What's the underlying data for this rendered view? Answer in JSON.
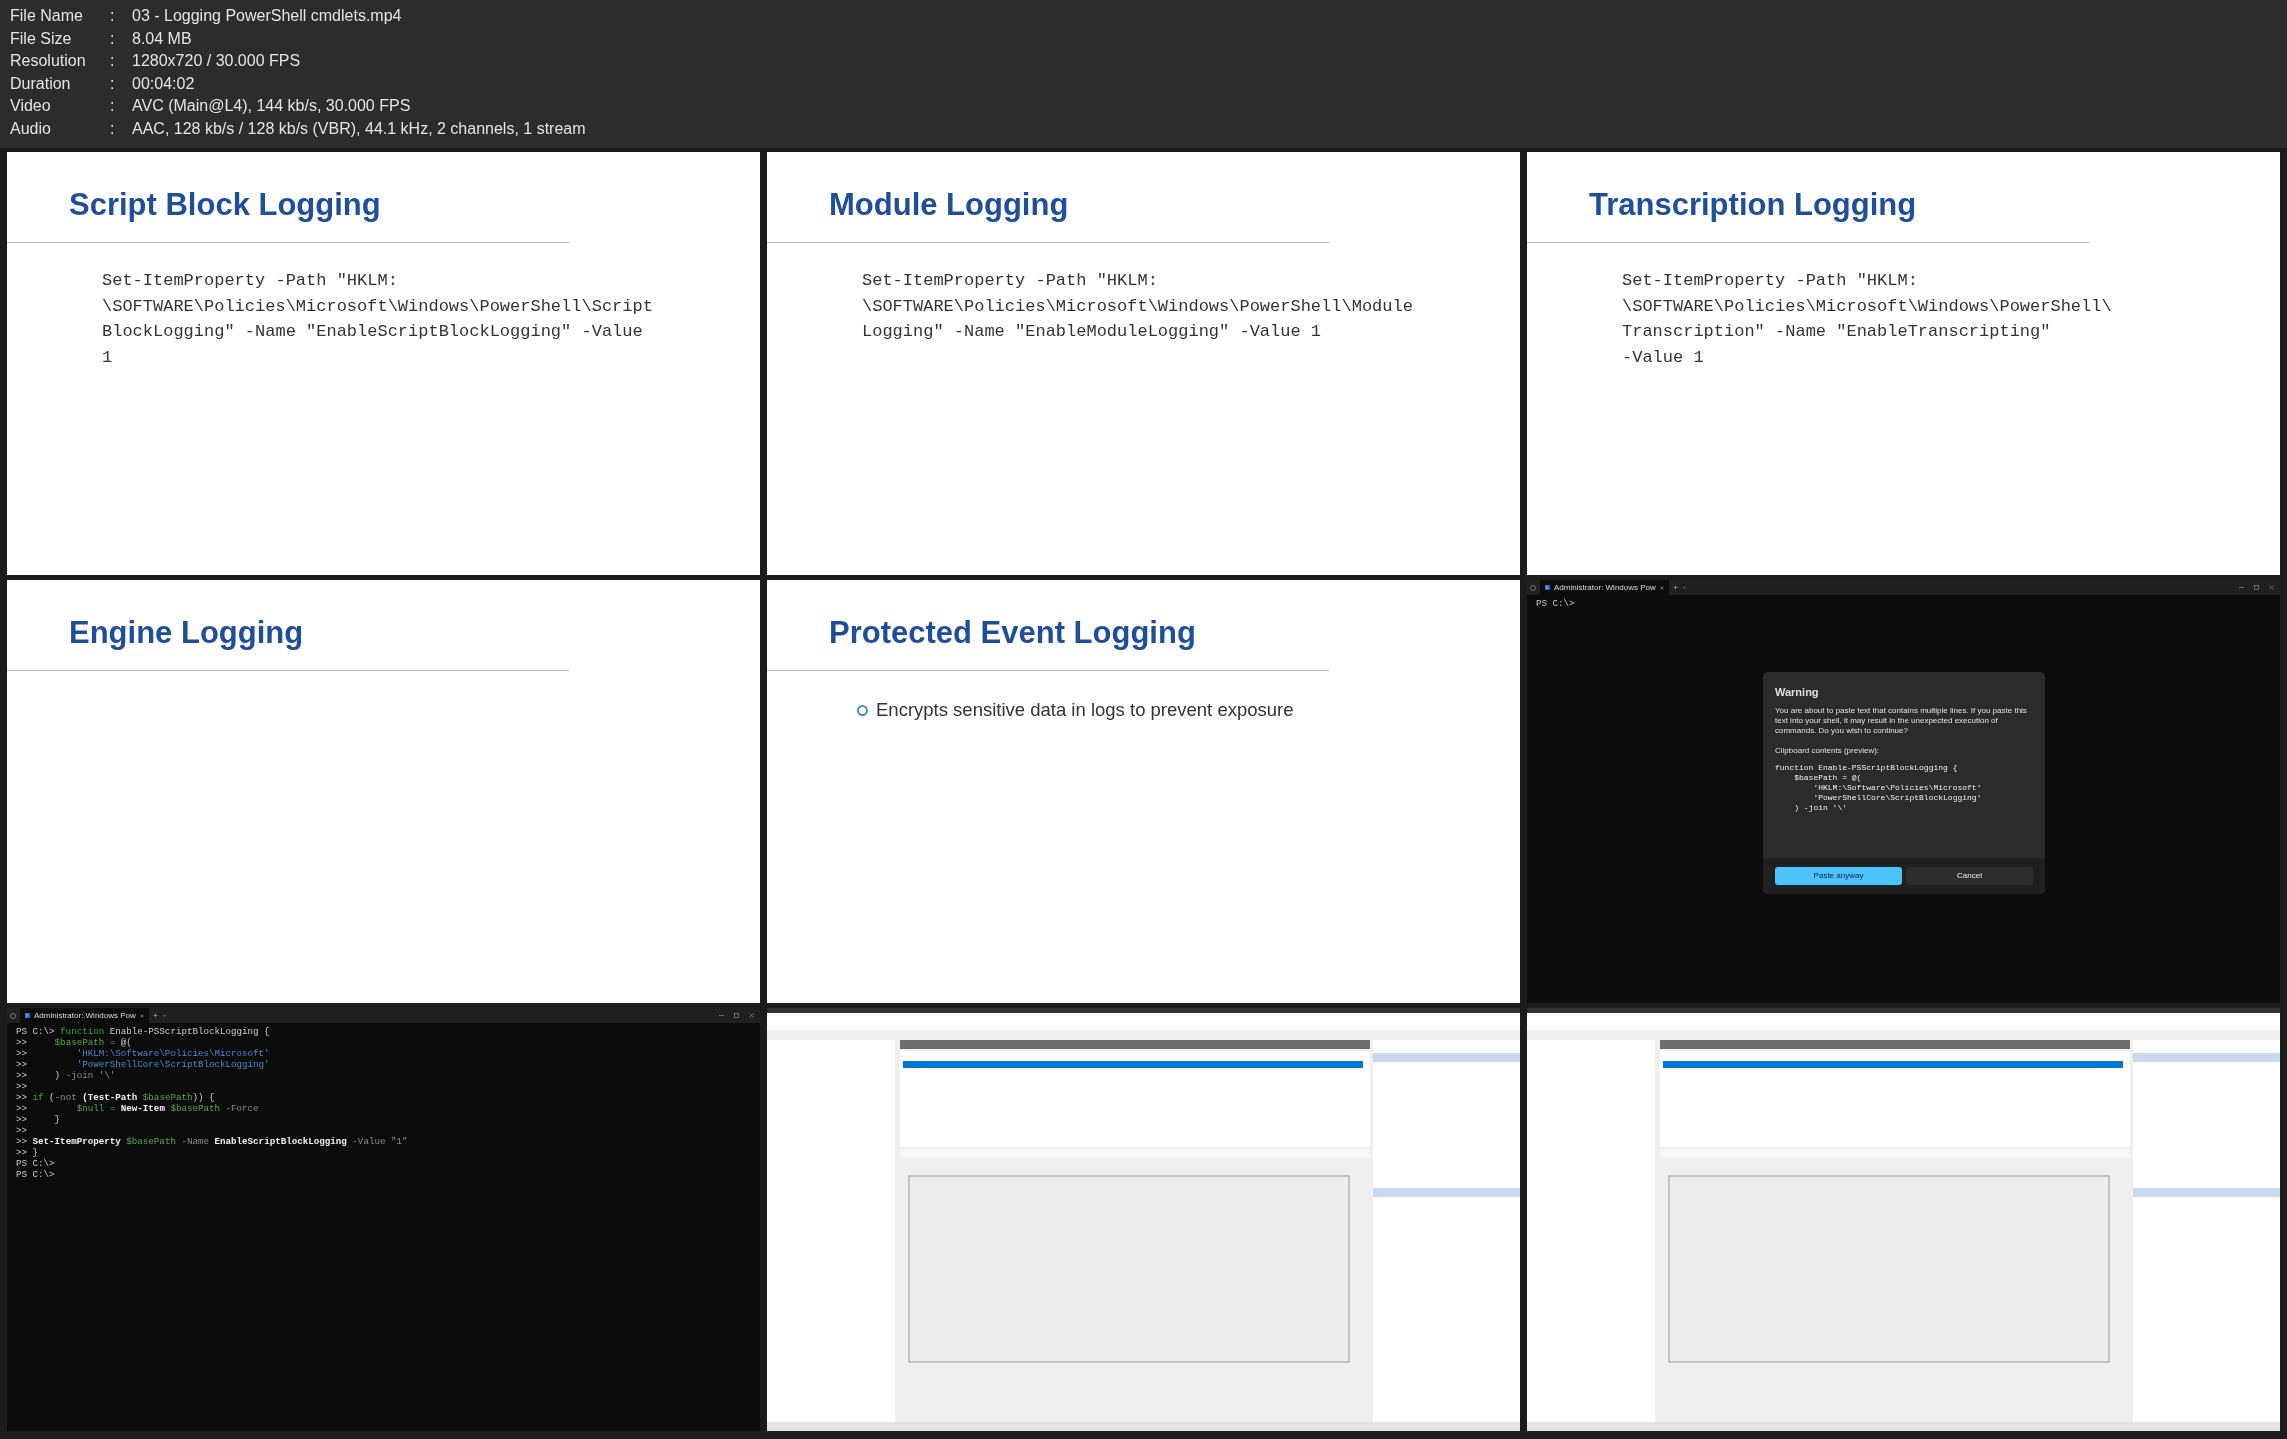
{
  "header": [
    {
      "label": "File Name",
      "separator": ":",
      "value": "03 - Logging PowerShell cmdlets.mp4"
    },
    {
      "label": "File Size",
      "separator": ":",
      "value": "8.04 MB"
    },
    {
      "label": "Resolution",
      "separator": ":",
      "value": "1280x720 / 30.000 FPS"
    },
    {
      "label": "Duration",
      "separator": ":",
      "value": "00:04:02"
    },
    {
      "label": "Video",
      "separator": ":",
      "value": "AVC (Main@L4), 144 kb/s, 30.000 FPS"
    },
    {
      "label": "Audio",
      "separator": ":",
      "value": "AAC, 128 kb/s / 128 kb/s (VBR), 44.1 kHz, 2 channels, 1 stream"
    }
  ],
  "frames": [
    {
      "kind": "slide",
      "title": "Script Block Logging",
      "code": [
        "Set-ItemProperty -Path \"HKLM:",
        "\\SOFTWARE\\Policies\\Microsoft\\Windows\\PowerShell\\Script",
        "BlockLogging\" -Name \"EnableScriptBlockLogging\" -Value",
        "1"
      ]
    },
    {
      "kind": "slide",
      "title": "Module Logging",
      "code": [
        "Set-ItemProperty -Path \"HKLM:",
        "\\SOFTWARE\\Policies\\Microsoft\\Windows\\PowerShell\\Module",
        "Logging\" -Name \"EnableModuleLogging\" -Value 1"
      ]
    },
    {
      "kind": "slide",
      "title": "Transcription Logging",
      "code": [
        "Set-ItemProperty -Path \"HKLM:",
        "\\SOFTWARE\\Policies\\Microsoft\\Windows\\PowerShell\\",
        "Transcription\" -Name \"EnableTranscripting\"",
        "-Value 1"
      ]
    },
    {
      "kind": "slide",
      "title": "Engine Logging"
    },
    {
      "kind": "slide",
      "title": "Protected Event Logging",
      "bullets": [
        "Encrypts sensitive data in logs to prevent exposure"
      ]
    },
    {
      "kind": "terminal",
      "tab_title": "Administrator: Windows Pow",
      "lines": [
        [
          {
            "kind": "prompt",
            "text": "PS C:\\>"
          }
        ]
      ],
      "dialog": {
        "title": "Warning",
        "message": "You are about to paste text that contains multiple lines. If you paste this text into your shell, it may result in the unexpected execution of commands. Do you wish to continue?",
        "preview_label": "Clipboard contents (preview):",
        "preview": [
          "function Enable-PSScriptBlockLogging {",
          "    $basePath = @(",
          "        'HKLM:\\Software\\Policies\\Microsoft'",
          "        'PowerShellCore\\ScriptBlockLogging'",
          "    ) -join '\\'"
        ],
        "buttons": [
          {
            "label": "Paste anyway",
            "kind": "primary"
          },
          {
            "label": "Cancel",
            "kind": "secondary"
          }
        ]
      }
    },
    {
      "kind": "terminal",
      "tab_title": "Administrator: Windows Pow",
      "lines": [
        [
          {
            "kind": "prompt",
            "text": "PS C:\\> "
          },
          {
            "kind": "keyword",
            "text": "function"
          },
          {
            "kind": "plain",
            "text": " Enable-PSScriptBlockLogging {"
          }
        ],
        [
          {
            "kind": "prompt",
            "text": ">>     "
          },
          {
            "kind": "variable",
            "text": "$basePath"
          },
          {
            "kind": "parameter",
            "text": " ="
          },
          {
            "kind": "plain",
            "text": " @("
          }
        ],
        [
          {
            "kind": "prompt",
            "text": ">>         "
          },
          {
            "kind": "string",
            "text": "'HKLM:\\Software\\Policies\\Microsoft'"
          }
        ],
        [
          {
            "kind": "prompt",
            "text": ">>         "
          },
          {
            "kind": "string",
            "text": "'PowerShellCore\\ScriptBlockLogging'"
          }
        ],
        [
          {
            "kind": "prompt",
            "text": ">>     "
          },
          {
            "kind": "plain",
            "text": ")"
          },
          {
            "kind": "parameter",
            "text": " -join '\\'"
          }
        ],
        [
          {
            "kind": "prompt",
            "text": ">>"
          }
        ],
        [
          {
            "kind": "prompt",
            "text": ">> "
          },
          {
            "kind": "keyword",
            "text": "if"
          },
          {
            "kind": "plain",
            "text": " ("
          },
          {
            "kind": "parameter",
            "text": "-not"
          },
          {
            "kind": "command",
            "text": " (Test-Path "
          },
          {
            "kind": "variable",
            "text": "$basePath"
          },
          {
            "kind": "plain",
            "text": ")) {"
          }
        ],
        [
          {
            "kind": "prompt",
            "text": ">>         "
          },
          {
            "kind": "variable",
            "text": "$null"
          },
          {
            "kind": "parameter",
            "text": " = "
          },
          {
            "kind": "command",
            "text": "New-Item "
          },
          {
            "kind": "variable",
            "text": "$basePath"
          },
          {
            "kind": "parameter",
            "text": " -Force"
          }
        ],
        [
          {
            "kind": "prompt",
            "text": ">>     "
          },
          {
            "kind": "plain",
            "text": "}"
          }
        ],
        [
          {
            "kind": "prompt",
            "text": ">>"
          }
        ],
        [
          {
            "kind": "prompt",
            "text": ">> "
          },
          {
            "kind": "command",
            "text": "Set-ItemProperty "
          },
          {
            "kind": "variable",
            "text": "$basePath"
          },
          {
            "kind": "parameter",
            "text": " -Name"
          },
          {
            "kind": "command",
            "text": " EnableScriptBlockLogging"
          },
          {
            "kind": "parameter",
            "text": " -Value \"1\""
          }
        ],
        [
          {
            "kind": "prompt",
            "text": ">> }"
          }
        ],
        [
          {
            "kind": "prompt",
            "text": "PS C:\\>"
          }
        ],
        [
          {
            "kind": "prompt",
            "text": "PS C:\\>"
          }
        ]
      ]
    },
    {
      "kind": "picture"
    },
    {
      "kind": "picture"
    }
  ]
}
